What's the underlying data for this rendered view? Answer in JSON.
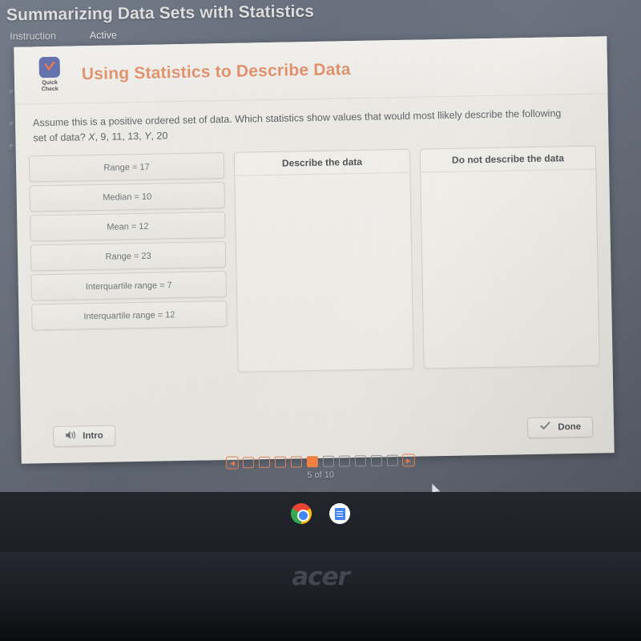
{
  "top": {
    "lesson_title": "Summarizing Data Sets with Statistics",
    "nav": [
      {
        "label": "Instruction"
      },
      {
        "label": "Active"
      }
    ]
  },
  "card": {
    "badge": {
      "icon": "checkmark-icon",
      "line1": "Quick",
      "line2": "Check"
    },
    "title": "Using Statistics to Describe Data",
    "prompt_line1": "Assume this is a positive ordered set of data. Which statistics show values that would most llikely describe the",
    "prompt_line2_lead": "following set of data? ",
    "prompt_var_x": "X",
    "prompt_numbers_1": ", 9, 11, 13, ",
    "prompt_var_y": "Y",
    "prompt_numbers_2": ", 20"
  },
  "tiles": [
    {
      "label": "Range = 17"
    },
    {
      "label": "Median = 10"
    },
    {
      "label": "Mean = 12"
    },
    {
      "label": "Range = 23"
    },
    {
      "label": "Interquartile range = 7"
    },
    {
      "label": "Interquartile range = 12"
    }
  ],
  "dropzones": [
    {
      "title": "Describe the data",
      "items": []
    },
    {
      "title": "Do not describe the data",
      "items": []
    }
  ],
  "footer": {
    "intro_label": "Intro",
    "intro_icon": "speaker-icon",
    "done_label": "Done",
    "done_icon": "checkmark-icon"
  },
  "pagination": {
    "prev_icon": "triangle-left-icon",
    "next_icon": "triangle-right-icon",
    "total": 10,
    "current": 5,
    "label": "5 of 10",
    "accent_color": "#ef7b3c"
  },
  "taskbar": [
    {
      "name": "chrome-icon"
    },
    {
      "name": "google-docs-icon"
    }
  ],
  "device": {
    "brand": "acer"
  },
  "colors": {
    "accent_orange": "#ef7b3c",
    "title_orange": "#e08f6a",
    "badge_blue": "#5b6ba8",
    "screen_gray": "#646b78",
    "card_bg": "#e9e7e1"
  }
}
